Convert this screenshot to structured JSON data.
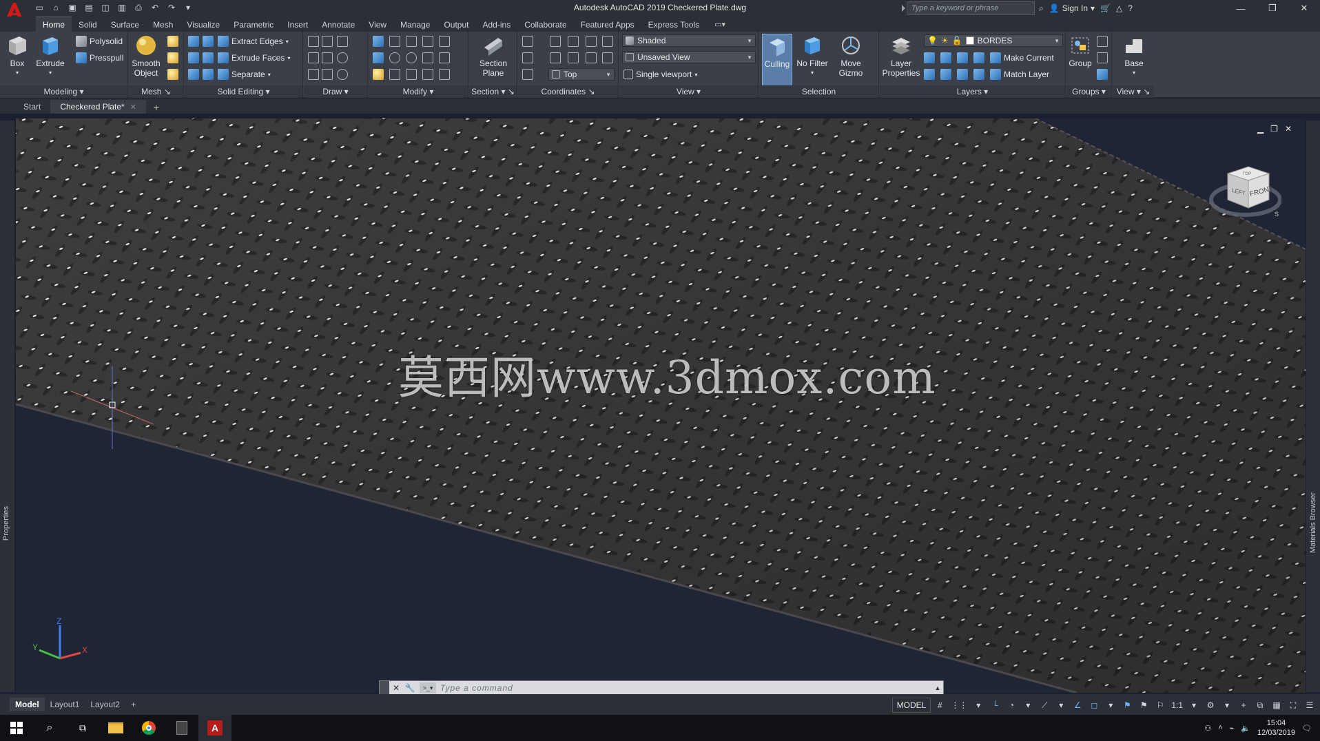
{
  "window": {
    "title": "Autodesk AutoCAD 2019    Checkered Plate.dwg"
  },
  "search": {
    "placeholder": "Type a keyword or phrase"
  },
  "account": {
    "sign_in": "Sign In"
  },
  "ribbon_tabs": [
    "Home",
    "Solid",
    "Surface",
    "Mesh",
    "Visualize",
    "Parametric",
    "Insert",
    "Annotate",
    "View",
    "Manage",
    "Output",
    "Add-ins",
    "Collaborate",
    "Featured Apps",
    "Express Tools"
  ],
  "active_ribbon_tab": "Home",
  "panels": {
    "modeling": {
      "title": "Modeling",
      "box": "Box",
      "extrude": "Extrude",
      "polysolid": "Polysolid",
      "presspull": "Presspull"
    },
    "mesh": {
      "title": "Mesh",
      "smooth_object": "Smooth Object",
      "smooth_line1": "Smooth",
      "smooth_line2": "Object"
    },
    "solid_editing": {
      "title": "Solid Editing",
      "extract_edges": "Extract Edges",
      "extrude_faces": "Extrude Faces",
      "separate": "Separate"
    },
    "draw": {
      "title": "Draw"
    },
    "modify": {
      "title": "Modify"
    },
    "section": {
      "title": "Section",
      "section_plane_1": "Section",
      "section_plane_2": "Plane"
    },
    "coordinates": {
      "title": "Coordinates",
      "view_dropdown": "Top"
    },
    "view": {
      "title": "View",
      "visual_style": "Shaded",
      "named_view": "Unsaved View",
      "viewport_config": "Single viewport"
    },
    "selection": {
      "title": "Selection",
      "culling": "Culling",
      "no_filter": "No Filter",
      "move_gizmo_1": "Move",
      "move_gizmo_2": "Gizmo"
    },
    "layers": {
      "title": "Layers",
      "layer_properties_1": "Layer",
      "layer_properties_2": "Properties",
      "current_layer": "BORDES",
      "make_current": "Make Current",
      "match_layer": "Match Layer"
    },
    "groups": {
      "title": "Groups",
      "group": "Group"
    },
    "view2": {
      "title": "View",
      "base": "Base"
    }
  },
  "doc_tabs": [
    {
      "label": "Start"
    },
    {
      "label": "Checkered Plate*"
    }
  ],
  "side": {
    "properties": "Properties",
    "materials_browser": "Materials Browser"
  },
  "viewcube": {
    "front": "FRONT",
    "left": "LEFT",
    "top": "TOP",
    "compass_s": "S"
  },
  "watermark": "莫西网www.3dmox.com",
  "command": {
    "placeholder": "Type a command"
  },
  "layout_tabs": [
    "Model",
    "Layout1",
    "Layout2"
  ],
  "status": {
    "model": "MODEL",
    "scale": "1:1"
  },
  "taskbar": {
    "time": "15:04",
    "date": "12/03/2019"
  },
  "colors": {
    "ribbon_bg": "#3b4048",
    "viewport_bg": "#1f2534",
    "plate": "#3a3a3a",
    "accent": "#6fb3ff"
  }
}
